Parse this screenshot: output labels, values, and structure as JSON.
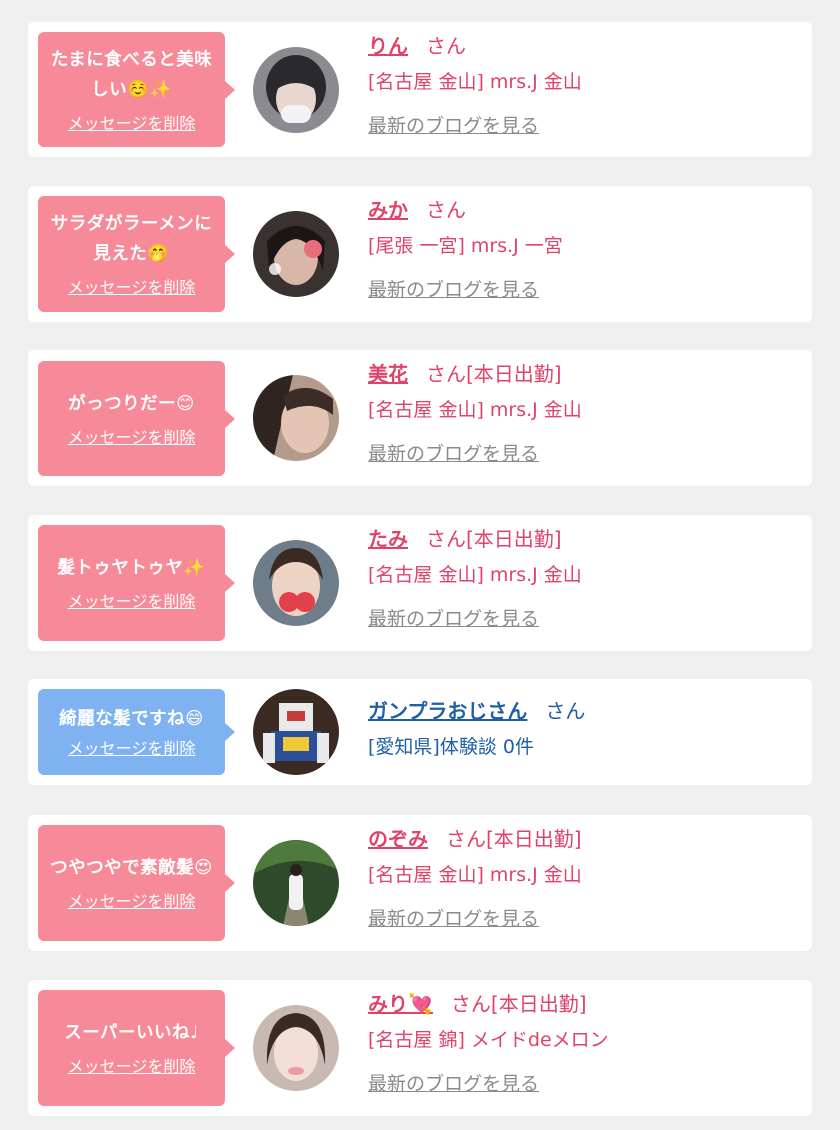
{
  "messages": [
    {
      "bubble_text": "たまに食べると美味しい☺️✨",
      "delete_label": "メッセージを削除",
      "bubble_color": "#f78a99",
      "name": "りん",
      "honorific": "さん",
      "status": "",
      "shop": "[名古屋 金山] mrs.J 金山",
      "link": "最新のブログを見る",
      "text_color": "#e0436a"
    },
    {
      "bubble_text": "サラダがラーメンに見えた🤭",
      "delete_label": "メッセージを削除",
      "bubble_color": "#f78a99",
      "name": "みか",
      "honorific": "さん",
      "status": "",
      "shop": "[尾張 一宮] mrs.J 一宮",
      "link": "最新のブログを見る",
      "text_color": "#e0436a"
    },
    {
      "bubble_text": "がっつりだー😊",
      "delete_label": "メッセージを削除",
      "bubble_color": "#f78a99",
      "name": "美花",
      "honorific": "さん",
      "status": "[本日出勤]",
      "shop": "[名古屋 金山] mrs.J 金山",
      "link": "最新のブログを見る",
      "text_color": "#e0436a"
    },
    {
      "bubble_text": "髪トゥヤトゥヤ✨",
      "delete_label": "メッセージを削除",
      "bubble_color": "#f78a99",
      "name": "たみ",
      "honorific": "さん",
      "status": "[本日出勤]",
      "shop": "[名古屋 金山] mrs.J 金山",
      "link": "最新のブログを見る",
      "text_color": "#e0436a"
    },
    {
      "bubble_text": "綺麗な髪ですね😄",
      "delete_label": "メッセージを削除",
      "bubble_color": "#7fb2f0",
      "name": "ガンプラおじさん",
      "honorific": "さん",
      "status": "",
      "shop": "[愛知県]体験談 0件",
      "link": "",
      "text_color": "#1f5ea8"
    },
    {
      "bubble_text": "つやつやで素敵髪😍",
      "delete_label": "メッセージを削除",
      "bubble_color": "#f78a99",
      "name": "のぞみ",
      "honorific": "さん",
      "status": "[本日出勤]",
      "shop": "[名古屋 金山] mrs.J 金山",
      "link": "最新のブログを見る",
      "text_color": "#e0436a"
    },
    {
      "bubble_text": "スーパーいいね♩",
      "delete_label": "メッセージを削除",
      "bubble_color": "#f78a99",
      "name": "みり💘",
      "honorific": "さん",
      "status": "[本日出勤]",
      "shop": "[名古屋 錦] メイドdeメロン",
      "link": "最新のブログを見る",
      "text_color": "#e0436a"
    }
  ]
}
